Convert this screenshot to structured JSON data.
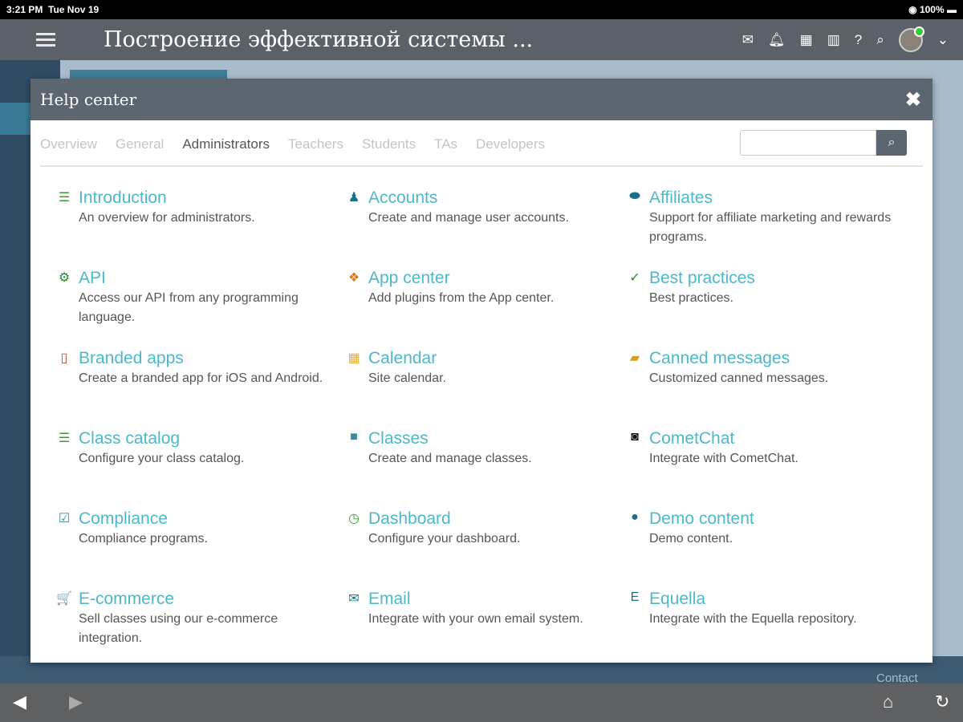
{
  "status": {
    "time": "3:21 PM",
    "date": "Tue Nov 19",
    "battery": "100%"
  },
  "header": {
    "title": "Построение эффективной системы ...",
    "icons": [
      "mail-icon",
      "bell-icon",
      "grid-icon",
      "trash-icon",
      "help-icon",
      "search-icon",
      "avatar",
      "chevron-down-icon"
    ]
  },
  "modal": {
    "title": "Help center",
    "close": "✖",
    "tabs": [
      {
        "label": "Overview"
      },
      {
        "label": "General"
      },
      {
        "label": "Administrators",
        "active": true
      },
      {
        "label": "Teachers"
      },
      {
        "label": "Students"
      },
      {
        "label": "TAs"
      },
      {
        "label": "Developers"
      }
    ],
    "search": {
      "value": "",
      "placeholder": ""
    },
    "items": [
      {
        "name": "Introduction",
        "desc": "An overview for administrators.",
        "icon": "list-icon",
        "glyph": "☰",
        "color": "#3a9a3a"
      },
      {
        "name": "Accounts",
        "desc": "Create and manage user accounts.",
        "icon": "users-icon",
        "glyph": "♟",
        "color": "#1a6f8a"
      },
      {
        "name": "Affiliates",
        "desc": "Support for affiliate marketing and rewards programs.",
        "icon": "handshake-icon",
        "glyph": "⬬",
        "color": "#1a6f8a"
      },
      {
        "name": "API",
        "desc": "Access our API from any programming language.",
        "icon": "gear-icon",
        "glyph": "⚙",
        "color": "#2a8a2a"
      },
      {
        "name": "App center",
        "desc": "Add plugins from the App center.",
        "icon": "puzzle-icon",
        "glyph": "❖",
        "color": "#d47a20"
      },
      {
        "name": "Best practices",
        "desc": "Best practices.",
        "icon": "check-icon",
        "glyph": "✓",
        "color": "#2a8a2a"
      },
      {
        "name": "Branded apps",
        "desc": "Create a branded app for iOS and Android.",
        "icon": "mobile-icon",
        "glyph": "▯",
        "color": "#d0502a"
      },
      {
        "name": "Calendar",
        "desc": "Site calendar.",
        "icon": "calendar-icon",
        "glyph": "▦",
        "color": "#e0b040"
      },
      {
        "name": "Canned messages",
        "desc": "Customized canned messages.",
        "icon": "chat-icon",
        "glyph": "▰",
        "color": "#d4a020"
      },
      {
        "name": "Class catalog",
        "desc": "Configure your class catalog.",
        "icon": "list-icon",
        "glyph": "☰",
        "color": "#3a9a3a"
      },
      {
        "name": "Classes",
        "desc": "Create and manage classes.",
        "icon": "classes-icon",
        "glyph": "■",
        "color": "#3a8aa0"
      },
      {
        "name": "CometChat",
        "desc": "Integrate with CometChat.",
        "icon": "cometchat-icon",
        "glyph": "◙",
        "color": "#111111"
      },
      {
        "name": "Compliance",
        "desc": "Compliance programs.",
        "icon": "clipboard-check-icon",
        "glyph": "☑",
        "color": "#3a8aa0"
      },
      {
        "name": "Dashboard",
        "desc": "Configure your dashboard.",
        "icon": "dashboard-icon",
        "glyph": "◷",
        "color": "#3a9a3a"
      },
      {
        "name": "Demo content",
        "desc": "Demo content.",
        "icon": "info-icon",
        "glyph": "●",
        "color": "#1a6f8a"
      },
      {
        "name": "E-commerce",
        "desc": "Sell classes using our e-commerce integration.",
        "icon": "cart-icon",
        "glyph": "🛒",
        "color": "#d4a020"
      },
      {
        "name": "Email",
        "desc": "Integrate with your own email system.",
        "icon": "mail-icon",
        "glyph": "✉",
        "color": "#1a6f8a"
      },
      {
        "name": "Equella",
        "desc": "Integrate with the Equella repository.",
        "icon": "equella-icon",
        "glyph": "E",
        "color": "#1a6f8a"
      }
    ]
  },
  "footer": {
    "contact": "Contact"
  },
  "toolbar": {
    "icons": [
      "back-icon",
      "forward-icon",
      "home-icon",
      "refresh-icon"
    ]
  }
}
